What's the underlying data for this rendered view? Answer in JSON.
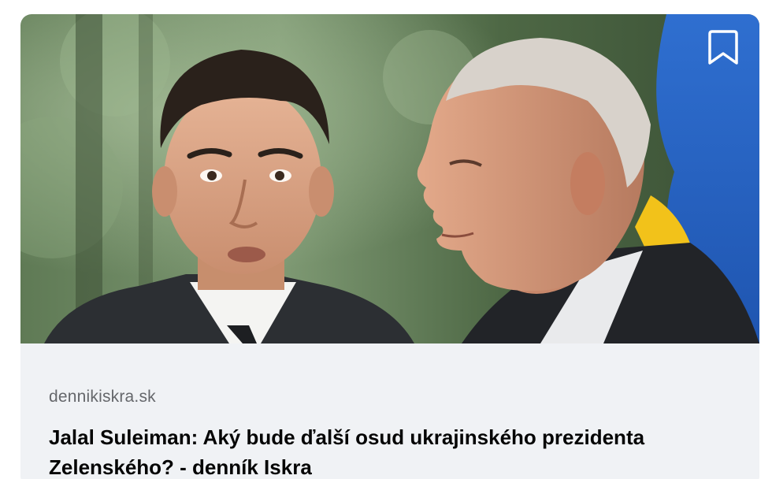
{
  "link_preview": {
    "image_alt": "",
    "domain": "dennikiskra.sk",
    "headline": "Jalal Suleiman: Aký bude ďalší osud ukrajinského prezidenta Zelenského? - denník Iskra",
    "bookmark_icon": "bookmark-icon"
  }
}
